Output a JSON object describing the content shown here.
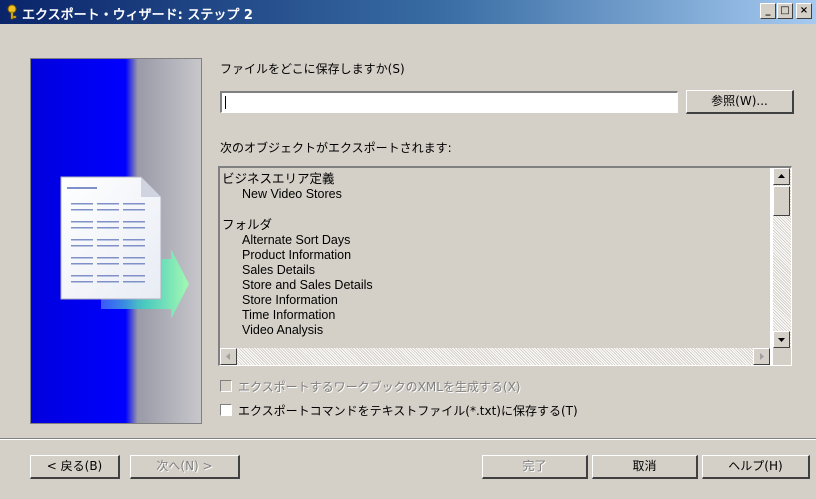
{
  "window": {
    "title": "エクスポート・ウィザード: ステップ 2",
    "minimize_label": "_",
    "maximize_label": "□",
    "close_label": "×"
  },
  "save_location": {
    "label": "ファイルをどこに保存しますか(S)",
    "value": "",
    "browse_label": "参照(W)..."
  },
  "objects": {
    "label": "次のオブジェクトがエクスポートされます:",
    "groups": [
      {
        "heading": "ビジネスエリア定義",
        "items": [
          "New Video Stores"
        ]
      },
      {
        "heading": "フォルダ",
        "items": [
          "Alternate Sort Days",
          "Product Information",
          "Sales Details",
          "Store and Sales Details",
          "Store Information",
          "Time Information",
          "Video Analysis"
        ]
      }
    ]
  },
  "options": {
    "xml_label": "エクスポートするワークブックのXMLを生成する(X)",
    "xml_checked": false,
    "xml_enabled": false,
    "save_commands_label": "エクスポートコマンドをテキストファイル(*.txt)に保存する(T)",
    "save_commands_checked": false
  },
  "footer": {
    "back_label": "< 戻る(B)",
    "next_label": "次へ(N) >",
    "finish_label": "完了",
    "cancel_label": "取消",
    "help_label": "ヘルプ(H)"
  },
  "colors": {
    "title_start": "#0a246a",
    "title_end": "#a6caf0",
    "face": "#d4d0c8",
    "banner_blue": "#0000ee"
  },
  "icons": {
    "window": "wizard-key-icon",
    "scroll_up": "arrow-up-icon",
    "scroll_down": "arrow-down-icon",
    "scroll_left": "arrow-left-icon",
    "scroll_right": "arrow-right-icon",
    "export_document": "document-icon",
    "export_arrow": "arrow-right-icon"
  }
}
